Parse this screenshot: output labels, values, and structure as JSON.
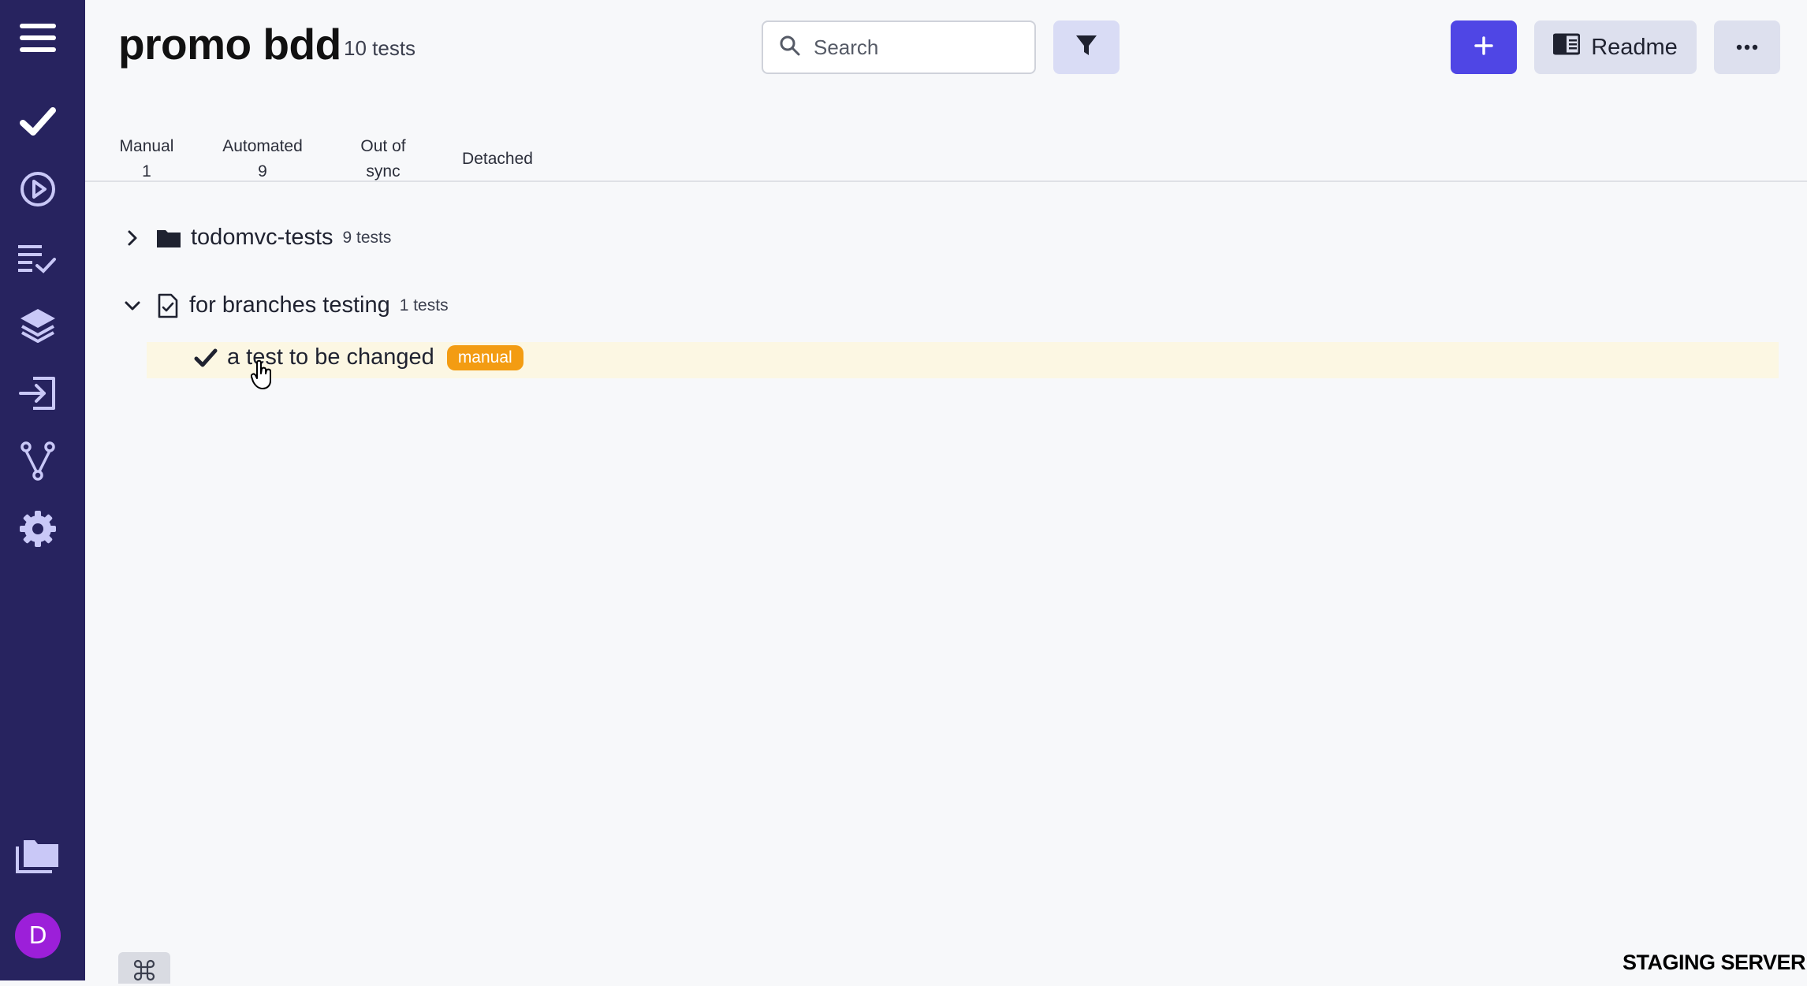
{
  "header": {
    "title": "promo bdd",
    "test_count": "10 tests",
    "search_placeholder": "Search",
    "readme_label": "Readme"
  },
  "tabs": [
    {
      "line1": "Manual",
      "line2": "1"
    },
    {
      "line1": "Automated",
      "line2": "9"
    },
    {
      "line1": "Out of",
      "line2": "sync"
    },
    {
      "line1": "Detached",
      "line2": ""
    }
  ],
  "tree": {
    "folder": {
      "label": "todomvc-tests",
      "count": "9 tests"
    },
    "suite": {
      "label": "for branches testing",
      "count": "1 tests"
    },
    "test": {
      "label": "a test to be changed",
      "badge": "manual"
    }
  },
  "sidebar": {
    "items": [
      "check-icon",
      "play-circle-icon",
      "checklist-icon",
      "layers-icon",
      "import-icon",
      "branch-icon",
      "settings-icon"
    ],
    "avatar_letter": "D"
  },
  "footer": {
    "env_label": "STAGING SERVER"
  },
  "colors": {
    "sidebar_bg": "#27235f",
    "sidebar_icon": "#c9c8f7",
    "accent": "#4f46e5",
    "badge": "#f39c12",
    "avatar": "#9c1fd9"
  }
}
